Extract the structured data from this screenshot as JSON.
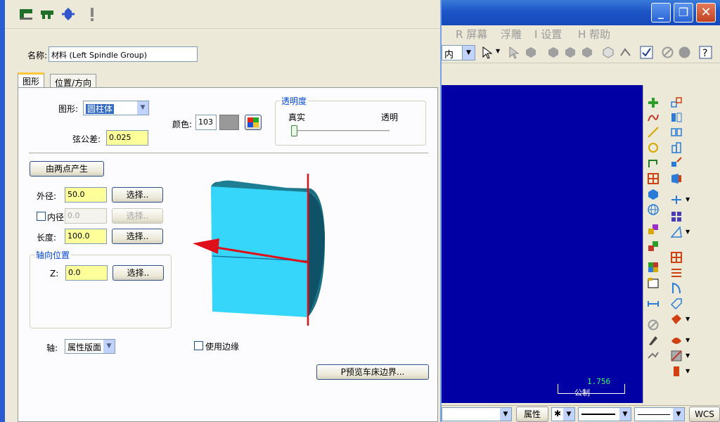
{
  "dialog": {
    "name_label": "名称:",
    "name_value": "材料 (Left Spindle Group)",
    "tabs": [
      {
        "label": "图形"
      },
      {
        "label": "位置/方向"
      }
    ],
    "shape_label": "图形:",
    "shape_value": "圆柱体",
    "chord_tol_label": "弦公差:",
    "chord_tol_value": "0.025",
    "color_label": "颜色:",
    "color_value": "103",
    "color_swatch": "#999999",
    "transparency": {
      "title": "透明度",
      "left_label": "真实",
      "right_label": "透明",
      "value": 0
    },
    "two_point_button": "由两点产生",
    "outer_diameter_label": "外径:",
    "outer_diameter_value": "50.0",
    "inner_diameter_label": "内径",
    "inner_diameter_value": "0.0",
    "inner_diameter_checked": false,
    "length_label": "长度:",
    "length_value": "100.0",
    "select_button": "选择..",
    "axial_group_title": "轴向位置",
    "z_label": "Z:",
    "z_value": "0.0",
    "axis_label": "轴:",
    "axis_value": "属性版面",
    "use_edge_label": "使用边缘",
    "use_edge_checked": false,
    "preview_button": "P预览车床边界..."
  },
  "app": {
    "menu": [
      {
        "label": "R 屏幕"
      },
      {
        "label": "浮雕"
      },
      {
        "label": "I 设置"
      },
      {
        "label": "H 帮助"
      }
    ],
    "toolbar_combo": "内",
    "scale_value": "1.756",
    "scale_unit": "公制",
    "status": {
      "attr_label": "属性",
      "wcs_label": "WCS"
    },
    "viewport_color": "#0000a5"
  }
}
